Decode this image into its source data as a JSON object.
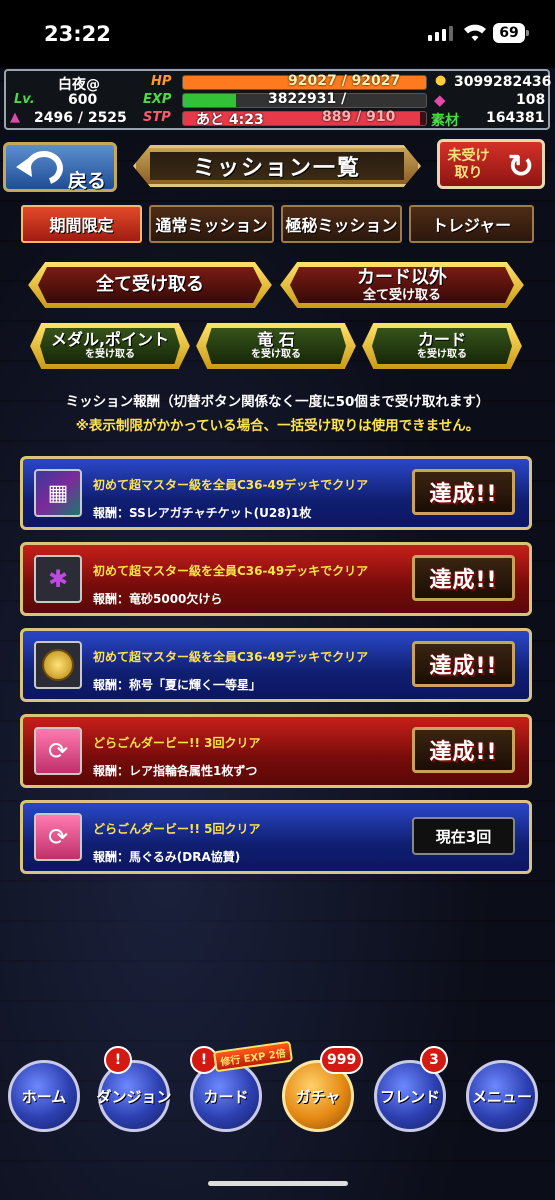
{
  "statusbar": {
    "time": "23:22",
    "battery": "69"
  },
  "player": {
    "name": "白夜@",
    "level_label": "Lv.",
    "level": "600",
    "stamina": "2496 / 2525",
    "hp_label": "HP",
    "hp_value": "92027 / 92027",
    "hp_fill": 1.0,
    "exp_label": "EXP",
    "exp_value": "3822931 /",
    "exp_fill": 0.22,
    "stp_label": "STP",
    "stp_timer": "あと 4:23",
    "stp_value": "889 / 910",
    "stp_fill": 0.977,
    "gold": "3099282436",
    "dragon_stone": "108",
    "material_label": "素材",
    "material": "164381"
  },
  "header": {
    "back_label": "戻る",
    "title": "ミッション一覧",
    "unreceived_label": "未受け取り"
  },
  "tabs": [
    {
      "label": "期間限定",
      "active": true
    },
    {
      "label": "通常ミッション",
      "active": false
    },
    {
      "label": "極秘ミッション",
      "active": false
    },
    {
      "label": "トレジャー",
      "active": false
    }
  ],
  "receive_buttons": {
    "all": {
      "line1": "全て受け取る"
    },
    "except_card": {
      "line1": "カード以外",
      "line2": "全て受け取る"
    },
    "medal": {
      "line1": "メダル,ポイント",
      "line2": "を受け取る"
    },
    "stone": {
      "line1": "竜 石",
      "line2": "を受け取る"
    },
    "card": {
      "line1": "カード",
      "line2": "を受け取る"
    }
  },
  "notice": {
    "line1": "ミッション報酬（切替ボタン関係なく一度に50個まで受け取れます）",
    "line2": "※表示制限がかかっている場合、一括受け取りは使用できません。"
  },
  "missions": [
    {
      "title": "初めて超マスター級を全員C36-49デッキでクリア",
      "reward": "報酬：SSレアガチャチケット(U28)1枚",
      "status": "達成!!",
      "color": "blue",
      "icon": "ticket-icon"
    },
    {
      "title": "初めて超マスター級を全員C36-49デッキでクリア",
      "reward": "報酬：竜砂5000欠けら",
      "status": "達成!!",
      "color": "red",
      "icon": "dragon-sand-icon"
    },
    {
      "title": "初めて超マスター級を全員C36-49デッキでクリア",
      "reward": "報酬：称号「夏に輝く一等星」",
      "status": "達成!!",
      "color": "blue",
      "icon": "medal-icon"
    },
    {
      "title": "どらごんダービー!! 3回クリア",
      "reward": "報酬：レア指輪各属性1枚ずつ",
      "status": "達成!!",
      "color": "red",
      "icon": "ring-card-icon"
    },
    {
      "title": "どらごんダービー!! 5回クリア",
      "reward": "報酬：馬ぐるみ(DRA協賛)",
      "status": "現在3回",
      "color": "blue",
      "icon": "ring-card-icon"
    }
  ],
  "nav": [
    {
      "label": "ホーム"
    },
    {
      "label": "ダンジョン",
      "badge": "!"
    },
    {
      "label": "カード",
      "badge": "!",
      "extra": "修行 EXP 2倍"
    },
    {
      "label": "ガチャ",
      "badge": "999"
    },
    {
      "label": "フレンド",
      "badge": "3"
    },
    {
      "label": "メニュー"
    }
  ],
  "colors": {
    "hp": "#ff7a1e",
    "exp": "#31c23a",
    "stp": "#e63a4a",
    "gold_border": "#f2cc3a"
  }
}
